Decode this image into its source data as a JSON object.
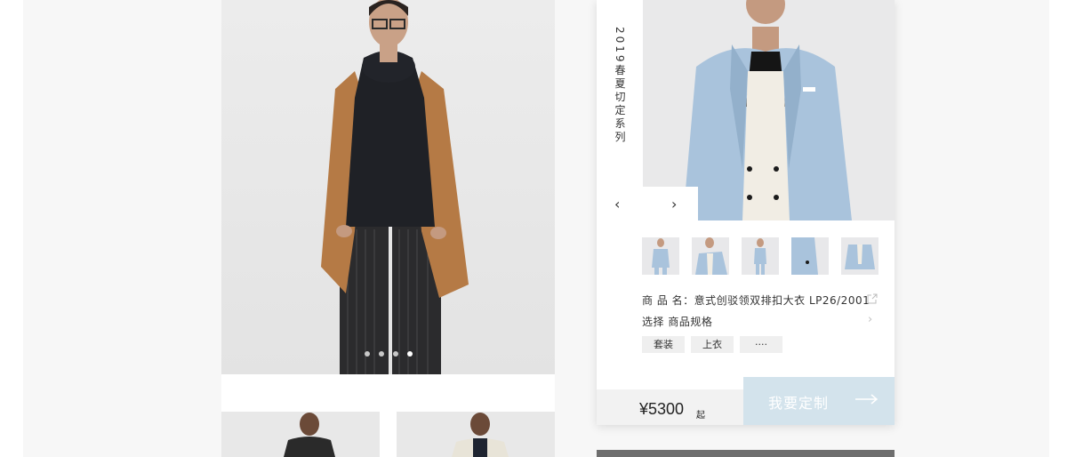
{
  "left_card": {
    "carousel_dots": 4,
    "active_dot": 3
  },
  "right_card": {
    "collection_title": "2019春夏切定系列",
    "product_name": "商 品 名：意式创驳领双排扣大衣 LP26/2001",
    "select_spec": "选择  商品规格",
    "tags": [
      "套装",
      "上衣",
      "····"
    ],
    "price": "¥5300",
    "price_suffix": "起",
    "cta_label": "我要定制"
  },
  "colors": {
    "cta_bg": "#d3e3ec",
    "accent_blue": "#a9c3dc",
    "coat_camel": "#b57a45"
  },
  "icons": [
    "chevron-left-icon",
    "chevron-right-icon",
    "share-icon",
    "chevron-right-small-icon",
    "arrow-right-icon"
  ]
}
